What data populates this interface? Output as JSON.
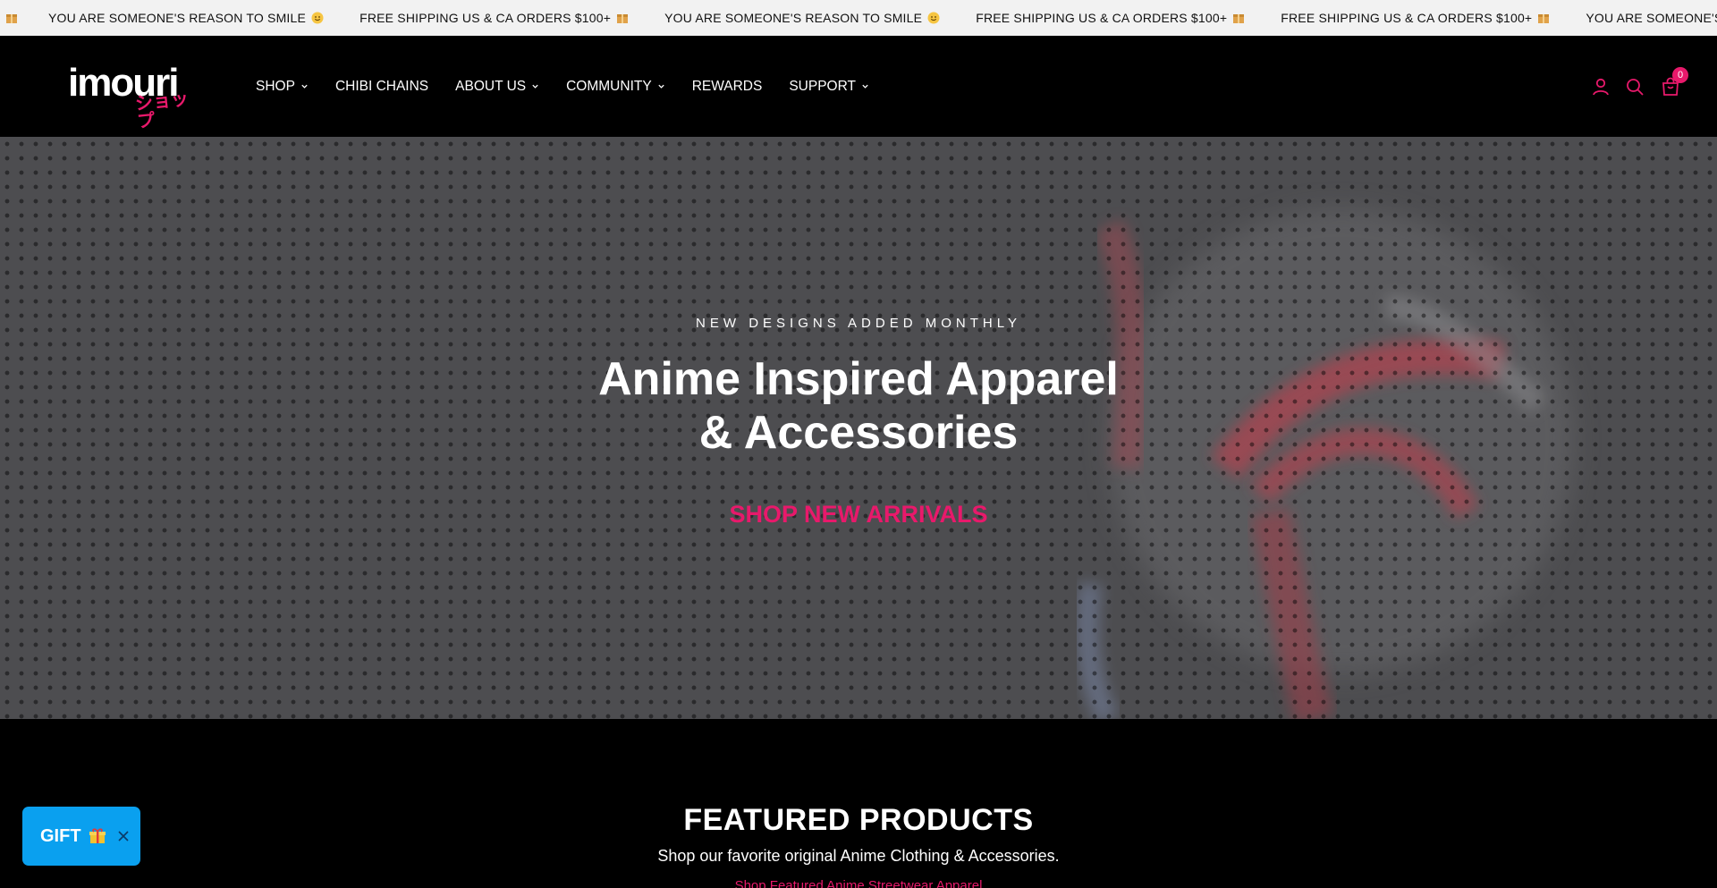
{
  "announcement": {
    "items": [
      {
        "text": "YOU ARE SOMEONE'S REASON TO SMILE",
        "icon": "smile-emoji-icon"
      },
      {
        "text": "FREE SHIPPING US & CA ORDERS $100+",
        "icon": "package-icon"
      },
      {
        "text": "YOU ARE SOMEONE'S REASON TO SMILE",
        "icon": "smile-emoji-icon"
      },
      {
        "text": "FREE SHIPPING US & CA ORDERS $100+",
        "icon": "package-icon"
      },
      {
        "text": "FREE SHIPPING US & CA ORDERS $100+",
        "icon": "package-icon"
      },
      {
        "text": "YOU ARE SOMEONE'S REASON TO SMILE",
        "icon": "smile-emoji-icon"
      }
    ]
  },
  "header": {
    "logo_text": "imouri",
    "logo_kana": "ショップ",
    "nav": [
      {
        "label": "SHOP",
        "dropdown": true
      },
      {
        "label": "CHIBI CHAINS",
        "dropdown": false
      },
      {
        "label": "ABOUT US",
        "dropdown": true
      },
      {
        "label": "COMMUNITY",
        "dropdown": true
      },
      {
        "label": "REWARDS",
        "dropdown": false
      },
      {
        "label": "SUPPORT",
        "dropdown": true
      }
    ],
    "icons": [
      "account-icon",
      "search-icon",
      "cart-icon"
    ],
    "cart_count": "0"
  },
  "hero": {
    "kicker": "NEW DESIGNS ADDED MONTHLY",
    "title_line1": "Anime Inspired Apparel",
    "title_line2": "& Accessories",
    "cta": "SHOP NEW ARRIVALS"
  },
  "featured": {
    "title": "FEATURED PRODUCTS",
    "subtitle": "Shop our favorite original Anime Clothing & Accessories.",
    "link": "Shop Featured Anime Streetwear Apparel"
  },
  "gift_widget": {
    "label": "GIFT",
    "icon": "gift-icon"
  },
  "colors": {
    "accent": "#e8196b",
    "header_bg": "#000000",
    "announcement_bg": "#f2f2f2",
    "gift_bg": "#0aa0ef"
  }
}
